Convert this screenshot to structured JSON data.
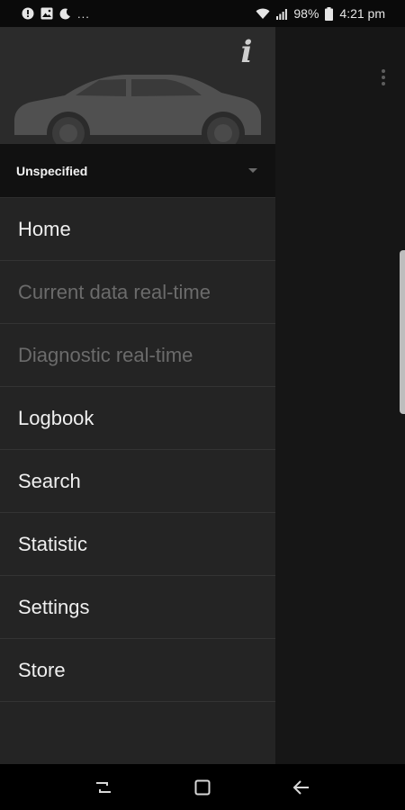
{
  "status_bar": {
    "time": "4:21 pm",
    "battery": "98%",
    "left_icons": [
      "alert-circle-icon",
      "image-icon",
      "moon-icon"
    ],
    "overflow": "...",
    "right_icons": [
      "wifi-icon",
      "signal-icon",
      "battery-icon"
    ]
  },
  "drawer": {
    "header": {
      "image": "car-silhouette",
      "info_icon": "info-icon",
      "info_glyph": "i"
    },
    "vehicle_selector": {
      "value": "Unspecified",
      "icon": "dropdown-arrow-icon"
    },
    "menu": [
      {
        "label": "Home",
        "enabled": true
      },
      {
        "label": "Current data real-time",
        "enabled": false
      },
      {
        "label": "Diagnostic real-time",
        "enabled": false
      },
      {
        "label": "Logbook",
        "enabled": true
      },
      {
        "label": "Search",
        "enabled": true
      },
      {
        "label": "Statistic",
        "enabled": true
      },
      {
        "label": "Settings",
        "enabled": true
      },
      {
        "label": "Store",
        "enabled": true
      }
    ]
  },
  "app": {
    "overflow_icon": "more-vert-icon"
  },
  "nav_bar": {
    "buttons": [
      "recents-icon",
      "home-square-icon",
      "back-arrow-icon"
    ]
  },
  "colors": {
    "drawer_bg": "#242424",
    "header_bg": "#2b2b2b",
    "selector_bg": "#111111",
    "text_enabled": "#efefef",
    "text_disabled": "#6b6b6b"
  }
}
